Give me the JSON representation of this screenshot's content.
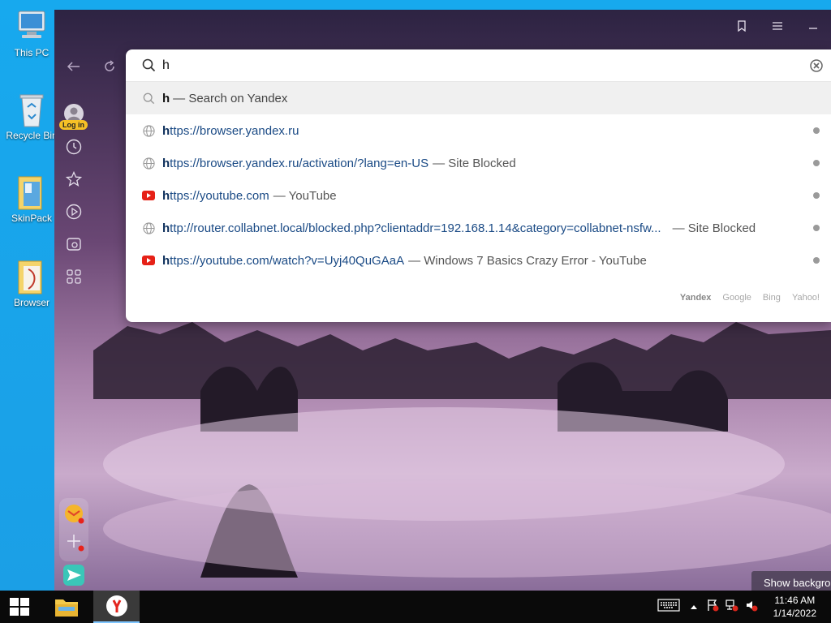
{
  "desktop": {
    "icons": [
      {
        "label": "This PC"
      },
      {
        "label": "Recycle Bin"
      },
      {
        "label": "SkinPack"
      },
      {
        "label": "Browser"
      }
    ]
  },
  "sidebar": {
    "login_label": "Log in"
  },
  "omnibox": {
    "query": "h",
    "suggestions": [
      {
        "type": "search",
        "bold": "h",
        "rest": " — Search on Yandex",
        "icon": "search-icon"
      },
      {
        "type": "site",
        "bold": "h",
        "url": "ttps://browser.yandex.ru",
        "title": "",
        "icon": "globe-icon"
      },
      {
        "type": "site",
        "bold": "h",
        "url": "ttps://browser.yandex.ru/activation/?lang=en-US",
        "title": "— Site Blocked",
        "icon": "globe-icon"
      },
      {
        "type": "site",
        "bold": "h",
        "url": "ttps://youtube.com",
        "title": "— YouTube",
        "icon": "youtube-icon"
      },
      {
        "type": "site",
        "bold": "h",
        "url": "ttp://router.collabnet.local/blocked.php?clientaddr=192.168.1.14&category=collabnet-nsfw...",
        "title": "— Site Blocked",
        "icon": "globe-icon"
      },
      {
        "type": "site",
        "bold": "h",
        "url": "ttps://youtube.com/watch?v=Uyj40QuGAaA",
        "title": "— Windows 7 Basics Crazy Error - YouTube",
        "icon": "youtube-icon"
      }
    ],
    "engines": [
      "Yandex",
      "Google",
      "Bing",
      "Yahoo!"
    ]
  },
  "background_button": "Show background",
  "taskbar": {
    "time": "11:46 AM",
    "date": "1/14/2022"
  },
  "colors": {
    "desktop": "#17a9ee",
    "taskbar": "#0a0a0a",
    "link": "#1a4a85",
    "youtube": "#e62117"
  }
}
